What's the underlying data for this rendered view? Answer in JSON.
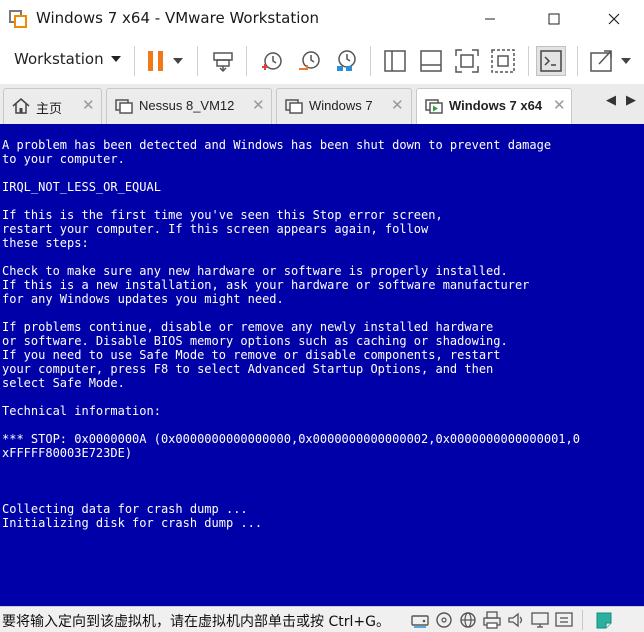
{
  "window": {
    "title": "Windows 7 x64 - VMware Workstation",
    "controls": [
      "minimize",
      "maximize",
      "close"
    ]
  },
  "toolbar": {
    "menu_label": "Workstation",
    "icons": [
      "pause-icon",
      "send-ctrl-alt-del-icon",
      "snapshot-icon",
      "revert-snapshot-icon",
      "snapshot-manager-icon",
      "show-library-icon",
      "thumbnail-bar-icon",
      "full-screen-icon",
      "unity-icon",
      "console-view-icon",
      "stretch-icon"
    ]
  },
  "tabs": [
    {
      "label": "主页",
      "icon": "home-icon",
      "active": false
    },
    {
      "label": "Nessus 8_VM12",
      "icon": "vm-icon",
      "active": false
    },
    {
      "label": "Windows 7",
      "icon": "vm-icon",
      "active": false
    },
    {
      "label": "Windows 7 x64",
      "icon": "vm-running-icon",
      "active": true
    }
  ],
  "screen": {
    "background": "#0000a8",
    "text": "A problem has been detected and Windows has been shut down to prevent damage\nto your computer.\n\nIRQL_NOT_LESS_OR_EQUAL\n\nIf this is the first time you've seen this Stop error screen,\nrestart your computer. If this screen appears again, follow\nthese steps:\n\nCheck to make sure any new hardware or software is properly installed.\nIf this is a new installation, ask your hardware or software manufacturer\nfor any Windows updates you might need.\n\nIf problems continue, disable or remove any newly installed hardware\nor software. Disable BIOS memory options such as caching or shadowing.\nIf you need to use Safe Mode to remove or disable components, restart\nyour computer, press F8 to select Advanced Startup Options, and then\nselect Safe Mode.\n\nTechnical information:\n\n*** STOP: 0x0000000A (0x0000000000000000,0x0000000000000002,0x0000000000000001,0\nxFFFFF80003E723DE)\n\n\n\nCollecting data for crash dump ...\nInitializing disk for crash dump ..."
  },
  "status": {
    "message": "要将输入定向到该虚拟机，请在虚拟机内部单击或按 Ctrl+G。",
    "device_icons": [
      "hard-disk-icon",
      "cd-drive-icon",
      "network-adapter-icon",
      "printer-icon",
      "sound-card-icon",
      "display-icon",
      "message-log-icon"
    ]
  }
}
